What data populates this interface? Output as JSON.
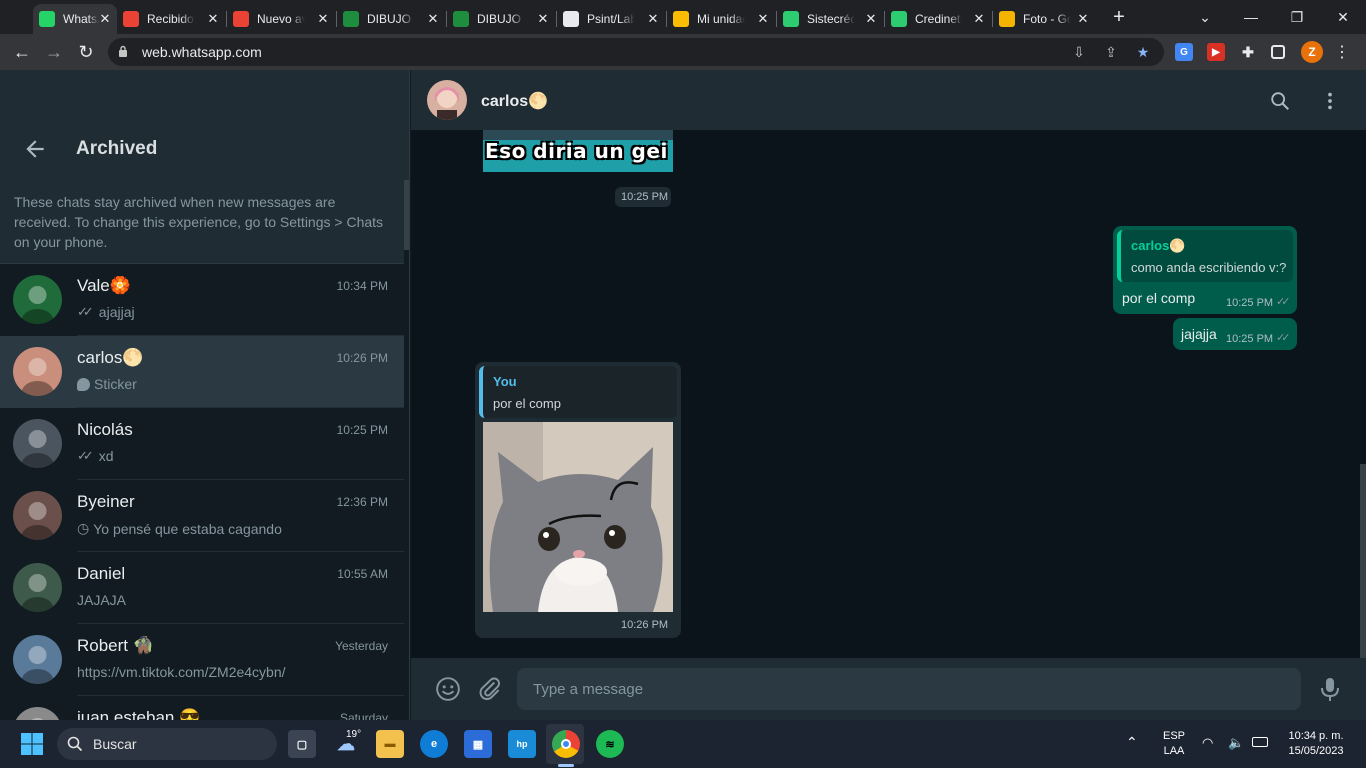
{
  "browser": {
    "tabs": [
      {
        "title": "WhatsApp",
        "icon": "whatsapp-icon",
        "color": "#25d366",
        "active": true
      },
      {
        "title": "Recibidos",
        "icon": "gmail-icon",
        "color": "#ea4335"
      },
      {
        "title": "Nuevo aviso",
        "icon": "gmail-icon",
        "color": "#ea4335"
      },
      {
        "title": "DIBUJO I",
        "icon": "classroom-icon",
        "color": "#1e8e3e"
      },
      {
        "title": "DIBUJO I",
        "icon": "classroom-icon",
        "color": "#1e8e3e"
      },
      {
        "title": "Psint/Lab",
        "icon": "github-icon",
        "color": "#e8eaed"
      },
      {
        "title": "Mi unidad",
        "icon": "drive-icon",
        "color": "#fbbc04"
      },
      {
        "title": "Sistecrédito",
        "icon": "site-icon",
        "color": "#2ecc71"
      },
      {
        "title": "Credinet",
        "icon": "site-icon",
        "color": "#2ecc71"
      },
      {
        "title": "Foto - Google",
        "icon": "photos-icon",
        "color": "#f4b400"
      }
    ],
    "url": "web.whatsapp.com",
    "profile_initial": "Z"
  },
  "sidebar": {
    "title": "Archived",
    "notice": "These chats stay archived when new messages are received. To change this experience, go to Settings > Chats on your phone.",
    "chats": [
      {
        "name": "Vale🏵️",
        "time": "10:34 PM",
        "preview": "ajajjaj",
        "status": "read",
        "avatar_color": "#1f6b3a"
      },
      {
        "name": "carlos🌕",
        "time": "10:26 PM",
        "preview": "Sticker",
        "status": "sticker",
        "avatar_color": "#c98e7c",
        "selected": true
      },
      {
        "name": "Nicolás",
        "time": "10:25 PM",
        "preview": "xd",
        "status": "read",
        "avatar_color": "#4a5560"
      },
      {
        "name": "Byeiner",
        "time": "12:36 PM",
        "preview": "Yo pensé que estaba cagando",
        "status": "pending",
        "avatar_color": "#6b4f4a"
      },
      {
        "name": "Daniel",
        "time": "10:55 AM",
        "preview": "JAJAJA",
        "status": "none",
        "avatar_color": "#3d5a4a"
      },
      {
        "name": "Robert 🧌",
        "time": "Yesterday",
        "preview": "https://vm.tiktok.com/ZM2e4cybn/",
        "status": "none",
        "avatar_color": "#5a7a9a"
      },
      {
        "name": "juan esteban 😎",
        "time": "Saturday",
        "preview": "",
        "status": "none",
        "avatar_color": "#8a8a8a"
      }
    ]
  },
  "conversation": {
    "contact_name": "carlos🌕",
    "sticker_caption": "Eso diria un gei",
    "sticker_time": "10:25 PM",
    "out_reply": {
      "quote_name": "carlos🌕",
      "quote_text": "como anda escribiendo v:?",
      "text": "por el comp",
      "time": "10:25 PM"
    },
    "out_msg": {
      "text": "jajajja",
      "time": "10:25 PM"
    },
    "in_reply": {
      "quote_name": "You",
      "quote_text": "por el comp",
      "time": "10:26 PM"
    },
    "composer_placeholder": "Type a message"
  },
  "taskbar": {
    "search_label": "Buscar",
    "weather_temp": "19°",
    "lang": "ESP",
    "layout": "LAA",
    "time": "10:34 p. m.",
    "date": "15/05/2023"
  },
  "colors": {
    "accent": "#00a884",
    "outgoing_bubble": "#005c4b",
    "incoming_bubble": "#202c33"
  }
}
